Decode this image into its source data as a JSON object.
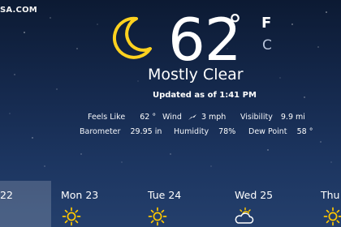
{
  "watermark": "SA.COM",
  "current": {
    "temperature": "62",
    "degree_symbol": "°",
    "unit_primary": "F",
    "unit_secondary": "C",
    "condition": "Mostly Clear",
    "updated": "Updated as of 1:41 PM",
    "icon": "moon-icon"
  },
  "details": {
    "feels_like": {
      "label": "Feels Like",
      "value": "62 °"
    },
    "wind": {
      "label": "Wind",
      "value": "3 mph",
      "icon": "wind-arrow-icon"
    },
    "visibility": {
      "label": "Visibility",
      "value": "9.9 mi"
    },
    "barometer": {
      "label": "Barometer",
      "value": "29.95 in"
    },
    "humidity": {
      "label": "Humidity",
      "value": "78%"
    },
    "dew_point": {
      "label": "Dew Point",
      "value": "58 °"
    }
  },
  "forecast": [
    {
      "name": "22",
      "icon": "",
      "selected": true
    },
    {
      "name": "Mon 23",
      "icon": "sun-icon"
    },
    {
      "name": "Tue 24",
      "icon": "sun-icon"
    },
    {
      "name": "Wed 25",
      "icon": "partly-cloudy-icon"
    },
    {
      "name": "Thu",
      "icon": "sun-icon"
    }
  ],
  "colors": {
    "moon": "#ffd21f",
    "sun": "#ffc800",
    "text": "#ffffff",
    "unit_inactive": "#b7c3d9",
    "background_top": "#0c1a33",
    "background_bottom": "#243f6c"
  }
}
